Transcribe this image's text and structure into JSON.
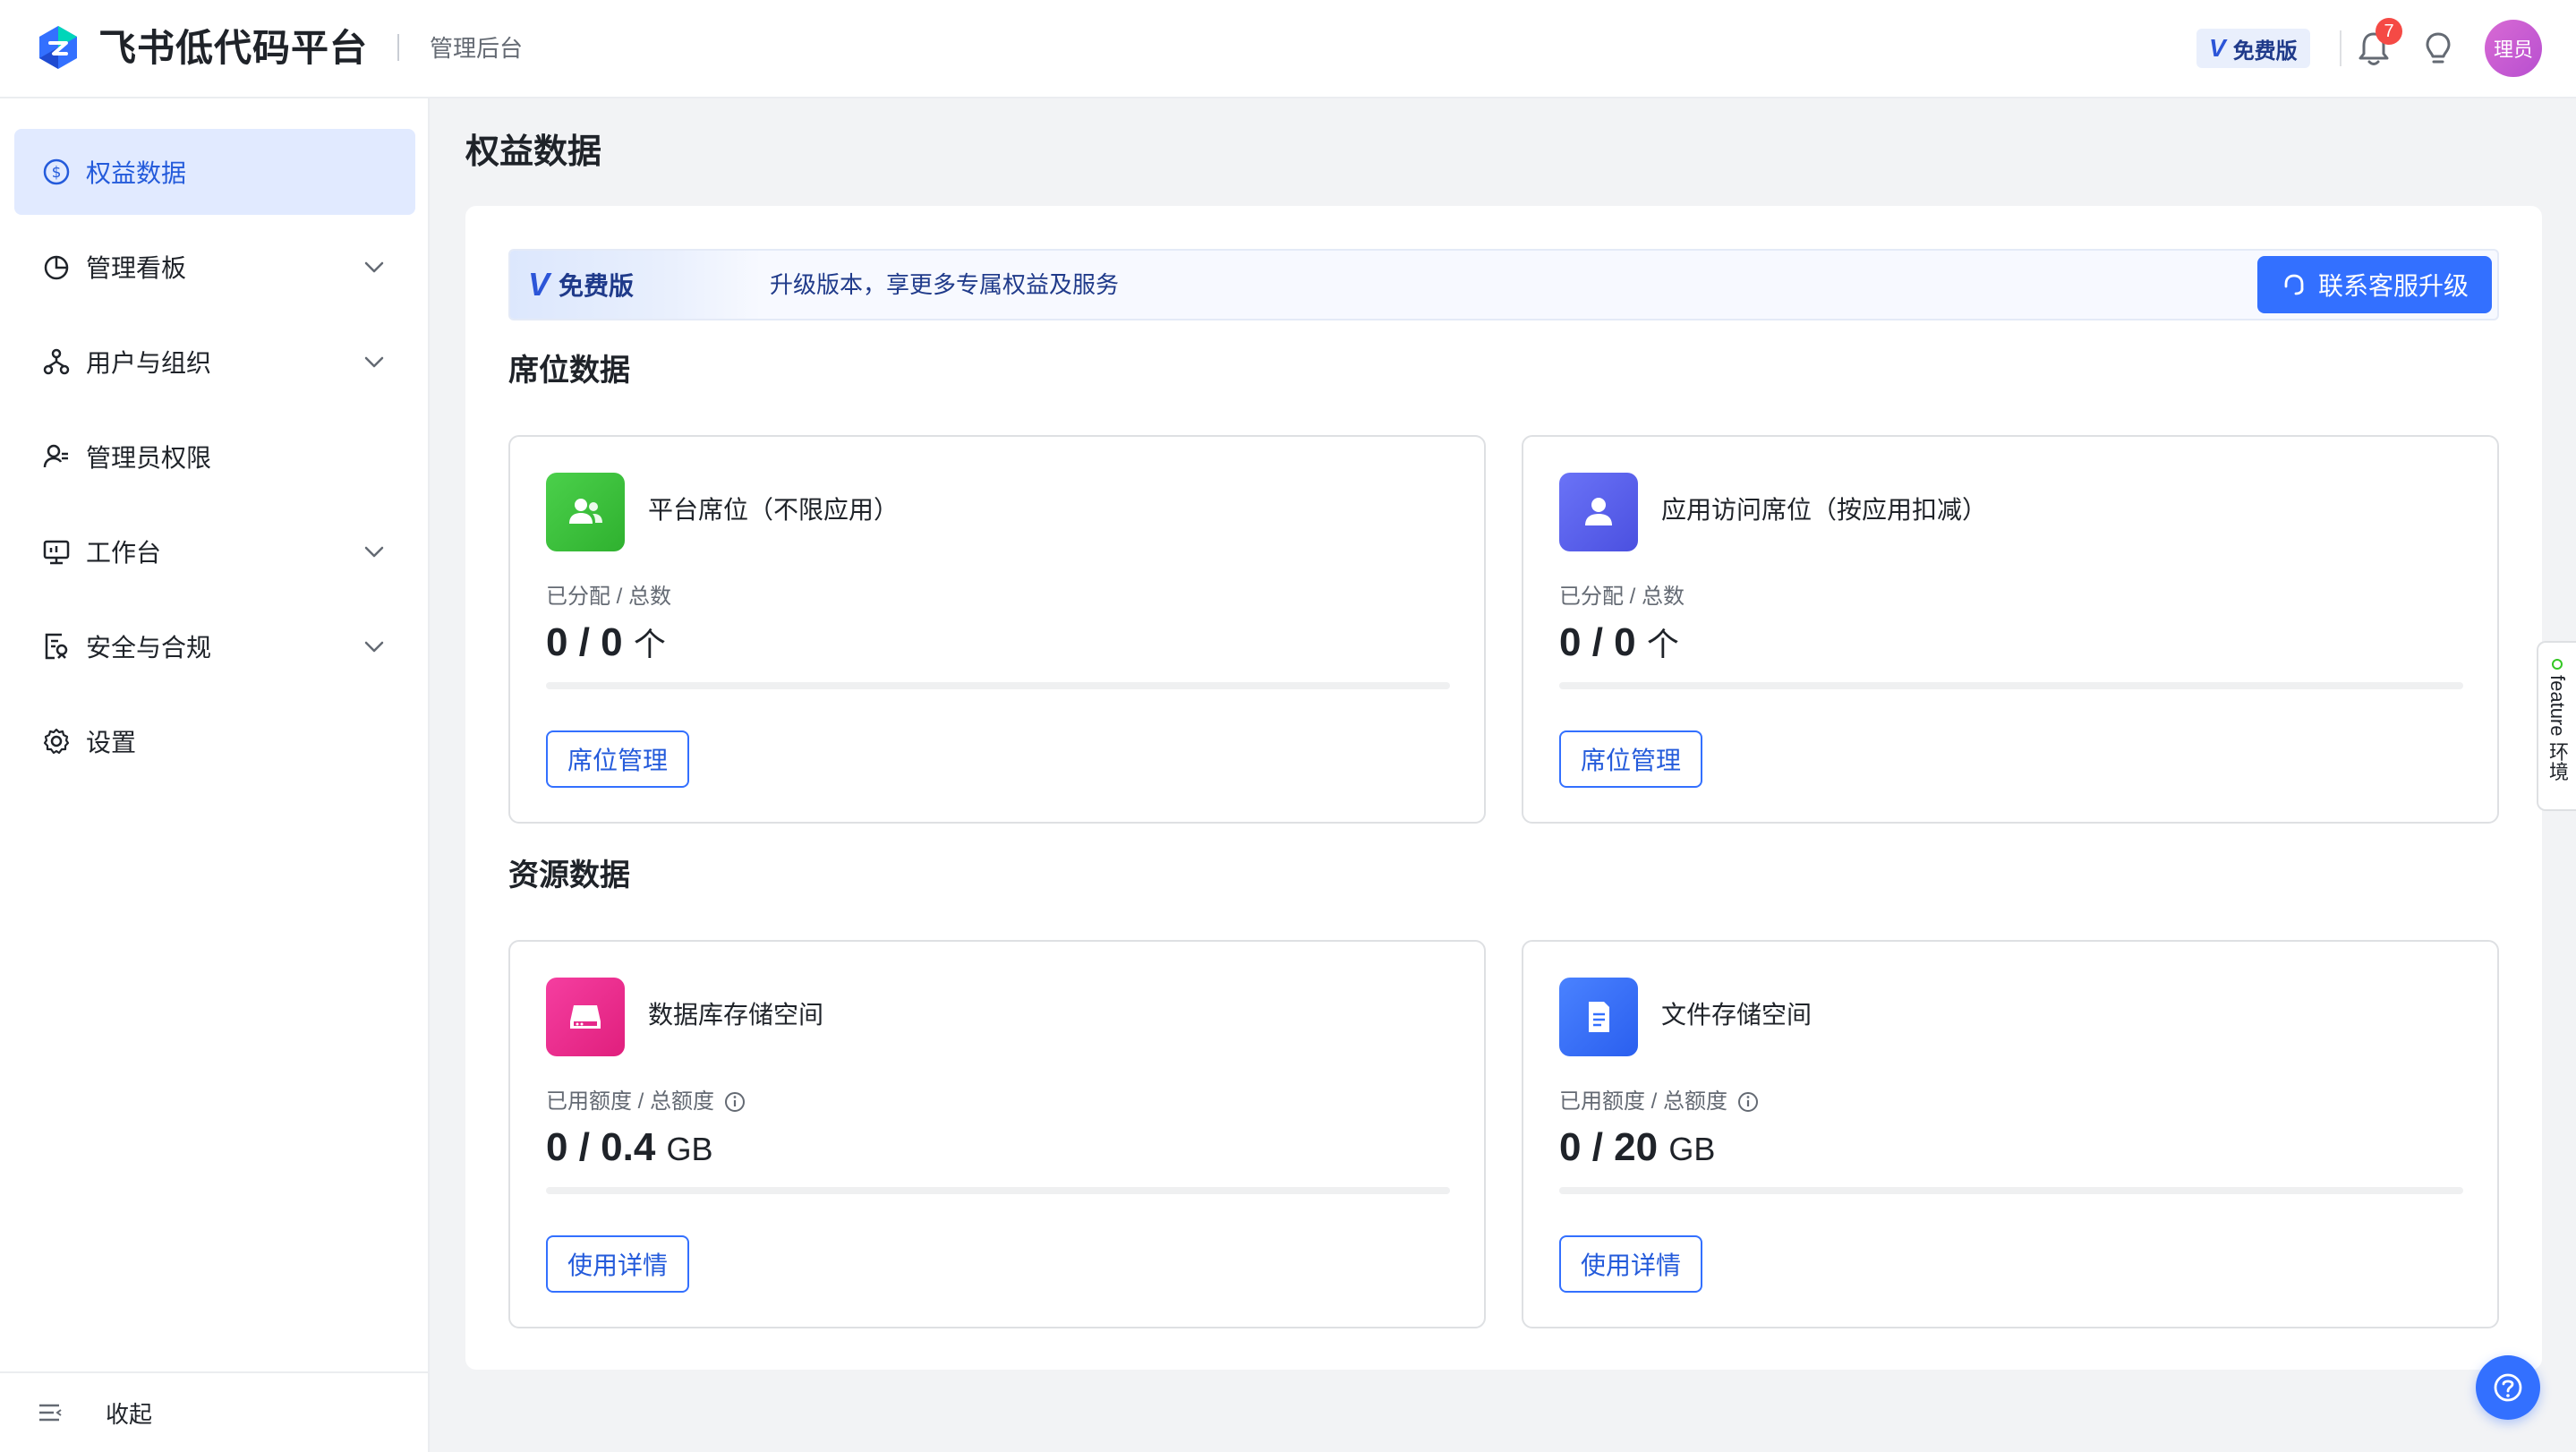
{
  "header": {
    "brand": "飞书低代码平台",
    "subtitle": "管理后台",
    "plan_badge": "免费版",
    "notification_count": "7",
    "avatar_text": "理员"
  },
  "sidebar": {
    "items": [
      {
        "label": "权益数据",
        "icon": "dollar-circle-icon",
        "active": true
      },
      {
        "label": "管理看板",
        "icon": "pie-chart-icon",
        "expandable": true
      },
      {
        "label": "用户与组织",
        "icon": "org-tree-icon",
        "expandable": true
      },
      {
        "label": "管理员权限",
        "icon": "admin-user-icon"
      },
      {
        "label": "工作台",
        "icon": "monitor-icon",
        "expandable": true
      },
      {
        "label": "安全与合规",
        "icon": "security-doc-icon",
        "expandable": true
      },
      {
        "label": "设置",
        "icon": "gear-icon"
      }
    ],
    "collapse_label": "收起"
  },
  "main": {
    "title": "权益数据",
    "banner": {
      "tag": "免费版",
      "text": "升级版本，享更多专属权益及服务",
      "button": "联系客服升级"
    },
    "seat_section": {
      "title": "席位数据",
      "cards": [
        {
          "name": "平台席位（不限应用）",
          "label": "已分配 / 总数",
          "value": "0 / 0",
          "unit": "个",
          "button": "席位管理",
          "progress": 0,
          "icon_color": "#34c724"
        },
        {
          "name": "应用访问席位（按应用扣减）",
          "label": "已分配 / 总数",
          "value": "0 / 0",
          "unit": "个",
          "button": "席位管理",
          "progress": 0,
          "icon_color": "#5b65f5"
        }
      ]
    },
    "resource_section": {
      "title": "资源数据",
      "cards": [
        {
          "name": "数据库存储空间",
          "label": "已用额度 / 总额度",
          "value": "0 / 0.4",
          "unit": "GB",
          "button": "使用详情",
          "progress": 0,
          "icon_color": "#f02d8d"
        },
        {
          "name": "文件存储空间",
          "label": "已用额度 / 总额度",
          "value": "0 / 20",
          "unit": "GB",
          "button": "使用详情",
          "progress": 0,
          "icon_color": "#3370ff"
        }
      ]
    }
  },
  "floating": {
    "feature_tab": "feature 环境"
  },
  "colors": {
    "accent": "#3370ff",
    "active_bg": "#e1eaff",
    "badge_red": "#f54a45"
  }
}
